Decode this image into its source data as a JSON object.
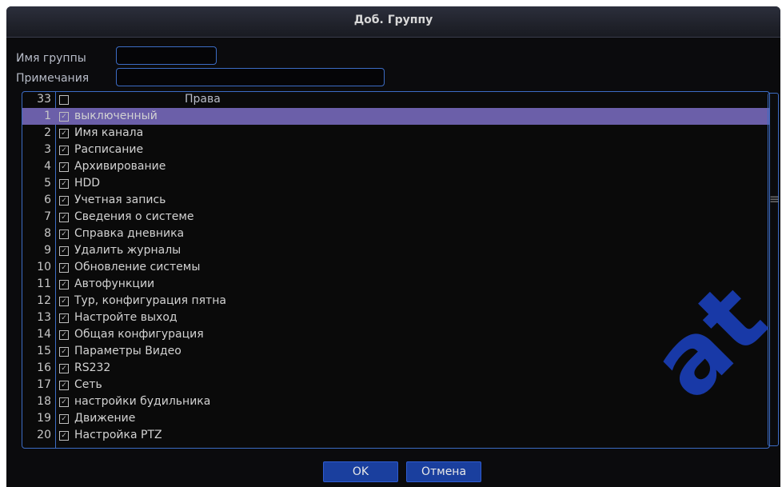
{
  "dialog": {
    "title": "Доб. Группу"
  },
  "form": {
    "group_name_label": "Имя группы",
    "group_name_value": "",
    "notes_label": "Примечания",
    "notes_value": ""
  },
  "table": {
    "count": "33",
    "header": "Права",
    "rows": [
      {
        "n": "1",
        "label": "выключенный",
        "checked": true,
        "selected": true
      },
      {
        "n": "2",
        "label": "Имя канала",
        "checked": true
      },
      {
        "n": "3",
        "label": "Расписание",
        "checked": true
      },
      {
        "n": "4",
        "label": "Архивирование",
        "checked": true
      },
      {
        "n": "5",
        "label": "HDD",
        "checked": true
      },
      {
        "n": "6",
        "label": "Учетная запись",
        "checked": true
      },
      {
        "n": "7",
        "label": "Сведения о системе",
        "checked": true
      },
      {
        "n": "8",
        "label": "Справка дневника",
        "checked": true
      },
      {
        "n": "9",
        "label": "Удалить журналы",
        "checked": true
      },
      {
        "n": "10",
        "label": "Обновление системы",
        "checked": true
      },
      {
        "n": "11",
        "label": "Автофункции",
        "checked": true
      },
      {
        "n": "12",
        "label": "Тур, конфигурация пятна",
        "checked": true
      },
      {
        "n": "13",
        "label": "Настройте выход",
        "checked": true
      },
      {
        "n": "14",
        "label": "Общая конфигурация",
        "checked": true
      },
      {
        "n": "15",
        "label": "Параметры Видео",
        "checked": true
      },
      {
        "n": "16",
        "label": "RS232",
        "checked": true
      },
      {
        "n": "17",
        "label": "Сеть",
        "checked": true
      },
      {
        "n": "18",
        "label": "настройки будильника",
        "checked": true
      },
      {
        "n": "19",
        "label": "Движение",
        "checked": true
      },
      {
        "n": "20",
        "label": "Настройка PTZ",
        "checked": true
      }
    ]
  },
  "buttons": {
    "ok": "OK",
    "cancel": "Отмена"
  },
  "colors": {
    "accent": "#3c6cc4",
    "selection": "#6b5fa9",
    "button": "#1a3f9e"
  }
}
